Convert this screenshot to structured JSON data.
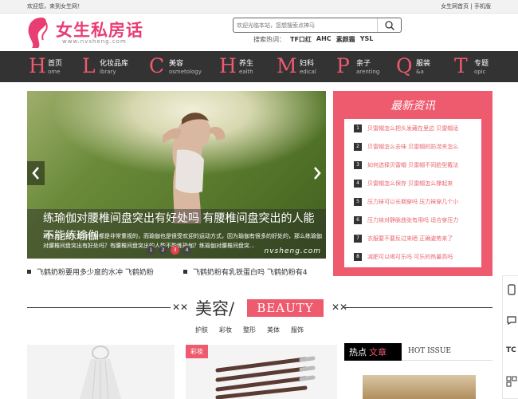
{
  "topbar": {
    "welcome": "欢迎您，来到女生网！",
    "right_links": "女生网首页 | 手机版"
  },
  "logo": {
    "text": "女生私房话",
    "url": "www.nvsheng.com"
  },
  "search": {
    "placeholder": "欢迎光临本站，您想搜索点神马",
    "hot_label": "搜索热词：",
    "hot_words": [
      "TF口红",
      "AHC",
      "素颜霜",
      "YSL"
    ]
  },
  "nav": [
    {
      "letter": "H",
      "cn": "首页",
      "en": "ome"
    },
    {
      "letter": "L",
      "cn": "化妆品库",
      "en": "ibrary"
    },
    {
      "letter": "C",
      "cn": "美容",
      "en": "osmetology"
    },
    {
      "letter": "H",
      "cn": "养生",
      "en": "ealth"
    },
    {
      "letter": "M",
      "cn": "妇科",
      "en": "edical"
    },
    {
      "letter": "P",
      "cn": "亲子",
      "en": "arenting"
    },
    {
      "letter": "Q",
      "cn": "服装",
      "en": "&a"
    },
    {
      "letter": "T",
      "cn": "专题",
      "en": "opic"
    }
  ],
  "banner": {
    "title": "练瑜伽对腰椎间盘突出有好处吗 有腰椎间盘突出的人能不能练瑜伽",
    "desc": "现在人们对于运动健身都是非常重视的，而瑜伽也是很受欢迎的运动方式，因为瑜伽有很多的好处的，那么练瑜伽对腰椎间盘突出有好处吗？有腰椎间盘突出的人能不能练瑜伽？练瑜伽对腰椎间盘突...",
    "dots": [
      "1",
      "2",
      "3",
      "4"
    ],
    "active_dot": 2,
    "watermark": "nvsheng.com"
  },
  "sublinks": [
    "飞鹤奶粉要用多少度的水冲 飞鹤奶粉",
    "飞鹤奶粉有乳铁蛋白吗 飞鹤奶粉有4"
  ],
  "news": {
    "title": "最新资讯",
    "items": [
      {
        "num": "1",
        "text": "贝雷帽怎么把头发藏在里边 贝雷帽适"
      },
      {
        "num": "2",
        "text": "贝雷帽怎么去味 贝雷帽的防涝夹怎么"
      },
      {
        "num": "3",
        "text": "如何选择贝雷帽 贝雷帽不同脸型戴法"
      },
      {
        "num": "4",
        "text": "贝雷帽怎么保存 贝雷帽怎么撑起来"
      },
      {
        "num": "5",
        "text": "压力袜可以长期穿吗 压力袜穿几个小"
      },
      {
        "num": "6",
        "text": "压力袜对静脉曲张有用吗 适合穿压力"
      },
      {
        "num": "7",
        "text": "衣服要不要反过来晒 正确姿势来了"
      },
      {
        "num": "8",
        "text": "减肥可以喝可乐吗 可乐的热量高吗"
      }
    ]
  },
  "section": {
    "cn": "美容/",
    "en": "BEAUTY",
    "tabs": [
      "护肤",
      "彩妆",
      "整形",
      "美体",
      "服饰"
    ]
  },
  "card2": {
    "tag": "彩妆"
  },
  "hot": {
    "label1": "热点",
    "label2": "文章",
    "en": "HOT ISSUE"
  },
  "colors": {
    "accent": "#ee5a6e",
    "nav_bg": "#333333",
    "logo": "#e83e73"
  }
}
